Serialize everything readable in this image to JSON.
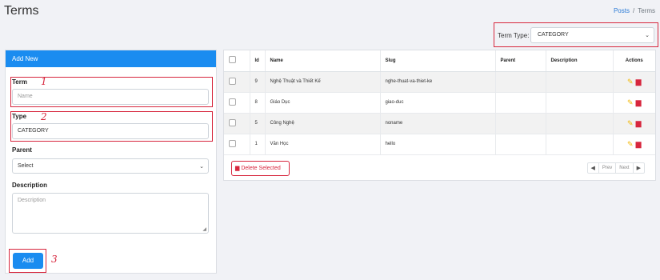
{
  "page": {
    "title": "Terms"
  },
  "breadcrumb": {
    "link": "Posts",
    "separator": "/",
    "current": "Terms"
  },
  "filter": {
    "label": "Term Type:",
    "selected": "CATEGORY"
  },
  "form": {
    "header": "Add New",
    "term": {
      "label": "Term",
      "placeholder": "Name"
    },
    "type": {
      "label": "Type",
      "value": "CATEGORY"
    },
    "parent": {
      "label": "Parent",
      "selected": "Select"
    },
    "description": {
      "label": "Description",
      "placeholder": "Description"
    },
    "add_label": "Add"
  },
  "annotations": {
    "a1": "1",
    "a2": "2",
    "a3": "3"
  },
  "table": {
    "headers": {
      "id": "Id",
      "name": "Name",
      "slug": "Slug",
      "parent": "Parent",
      "description": "Description",
      "actions": "Actions"
    },
    "rows": [
      {
        "id": "9",
        "name": "Nghệ Thuật và Thiết Kế",
        "slug": "nghe-thuat-va-thiet-ke",
        "parent": "",
        "description": ""
      },
      {
        "id": "8",
        "name": "Giáo Dục",
        "slug": "giao-duc",
        "parent": "",
        "description": ""
      },
      {
        "id": "5",
        "name": "Công Nghệ",
        "slug": "noname",
        "parent": "",
        "description": ""
      },
      {
        "id": "1",
        "name": "Văn Học",
        "slug": "hello",
        "parent": "",
        "description": ""
      }
    ]
  },
  "footer": {
    "delete_label": "Delete Selected",
    "prev": "Prev",
    "next": "Next"
  },
  "colors": {
    "primary": "#1a8cf0",
    "danger": "#d7263d",
    "edit": "#f2b705"
  }
}
